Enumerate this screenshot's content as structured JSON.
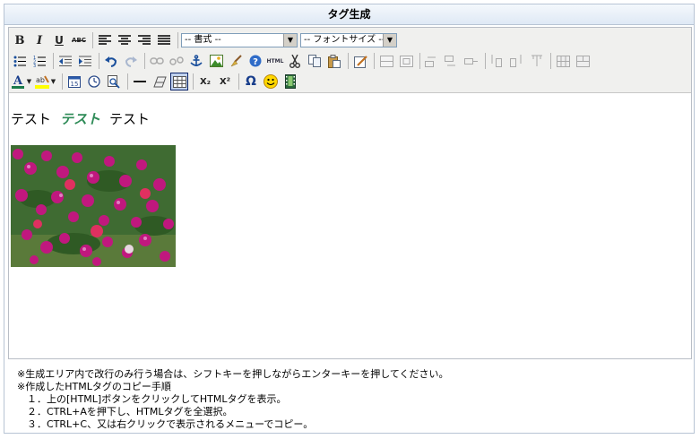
{
  "window": {
    "title": "タグ生成"
  },
  "toolbar": {
    "row1": {
      "bold": "B",
      "italic": "I",
      "underline": "U",
      "strike": "ABC",
      "format_select": "-- 書式 --",
      "font_size_select": "-- フォントサイズ --"
    },
    "row2": {
      "html": "HTML"
    },
    "row3": {
      "subscript": "X₂",
      "superscript": "X²",
      "omega": "Ω"
    }
  },
  "content": {
    "line_parts": [
      "テスト",
      "テスト",
      "テスト"
    ],
    "accent_color": "#2e8b57"
  },
  "notes": [
    "※生成エリア内で改行のみ行う場合は、シフトキーを押しながらエンターキーを押してください。",
    "※作成したHTMLタグのコピー手順",
    "　１．上の[HTML]ボタンをクリックしてHTMLタグを表示。",
    "　２．CTRL+Aを押下し、HTMLタグを全選択。",
    "　３．CTRL+C、又は右クリックで表示されるメニューでコピー。"
  ]
}
